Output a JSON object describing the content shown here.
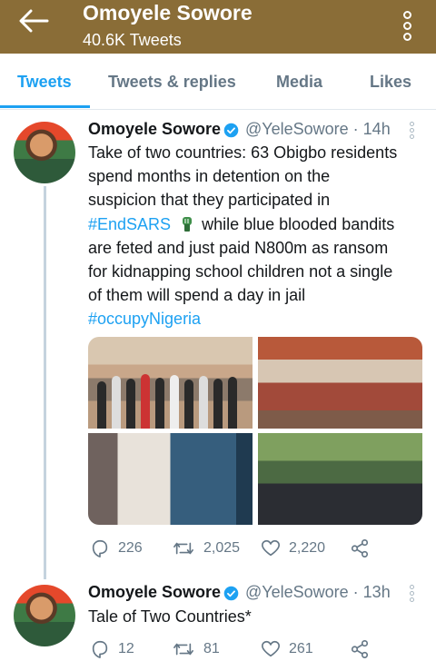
{
  "header": {
    "title": "Omoyele Sowore",
    "subtitle": "40.6K Tweets",
    "bar_color": "#8a6d37",
    "back_icon": "arrow-left-icon",
    "menu_icon": "more-vertical-icon"
  },
  "tabs": [
    {
      "label": "Tweets",
      "active": true
    },
    {
      "label": "Tweets & replies",
      "active": false
    },
    {
      "label": "Media",
      "active": false
    },
    {
      "label": "Likes",
      "active": false
    }
  ],
  "accent_color": "#1da1f2",
  "tweets": [
    {
      "name": "Omoyele Sowore",
      "handle_time": "@YeleSowore · 14h",
      "text_lines": [
        "Take of two countries: 63 Obigbo residents",
        "spend months in detention on the",
        "suspicion that they participated in"
      ],
      "hashtag1": "#EndSARS",
      "emoji_icon": "endsars-fist-emoji",
      "after_hashtag": " while blue blooded bandits",
      "text_lines2": [
        "are feted and just paid N800m as ransom",
        "for kidnapping school children not a single",
        "of them will spend a day in jail"
      ],
      "hashtag2": "#occupyNigeria",
      "replies": "226",
      "retweets": "2,025",
      "likes": "2,220"
    },
    {
      "name": "Omoyele Sowore",
      "handle_time": "@YeleSowore · 13h",
      "text": "Tale of Two Countries*",
      "replies": "12",
      "retweets": "81",
      "likes": "261"
    }
  ]
}
